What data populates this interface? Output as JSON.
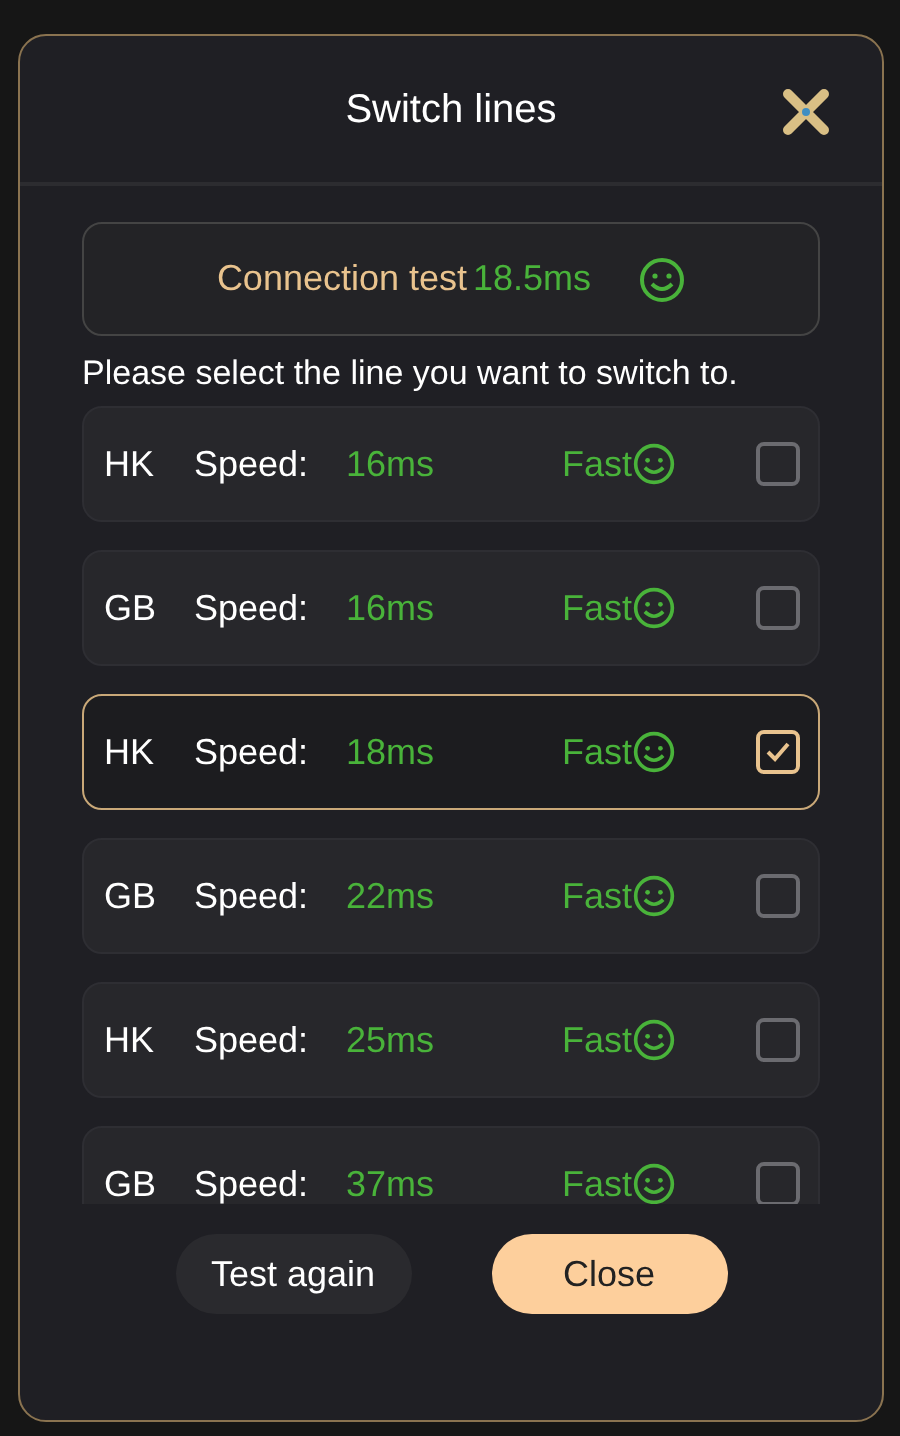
{
  "dialog": {
    "title": "Switch lines"
  },
  "connection_test": {
    "label": "Connection test",
    "value": "18.5ms"
  },
  "instruction": "Please select the line you want to switch to.",
  "lines": [
    {
      "region": "HK",
      "speed_label": "Speed:",
      "speed": "16ms",
      "rating": "Fast",
      "selected": false
    },
    {
      "region": "GB",
      "speed_label": "Speed:",
      "speed": "16ms",
      "rating": "Fast",
      "selected": false
    },
    {
      "region": "HK",
      "speed_label": "Speed:",
      "speed": "18ms",
      "rating": "Fast",
      "selected": true
    },
    {
      "region": "GB",
      "speed_label": "Speed:",
      "speed": "22ms",
      "rating": "Fast",
      "selected": false
    },
    {
      "region": "HK",
      "speed_label": "Speed:",
      "speed": "25ms",
      "rating": "Fast",
      "selected": false
    },
    {
      "region": "GB",
      "speed_label": "Speed:",
      "speed": "37ms",
      "rating": "Fast",
      "selected": false
    }
  ],
  "buttons": [
    {
      "label": "Test again",
      "kind": "secondary"
    },
    {
      "label": "Close",
      "kind": "primary"
    }
  ]
}
